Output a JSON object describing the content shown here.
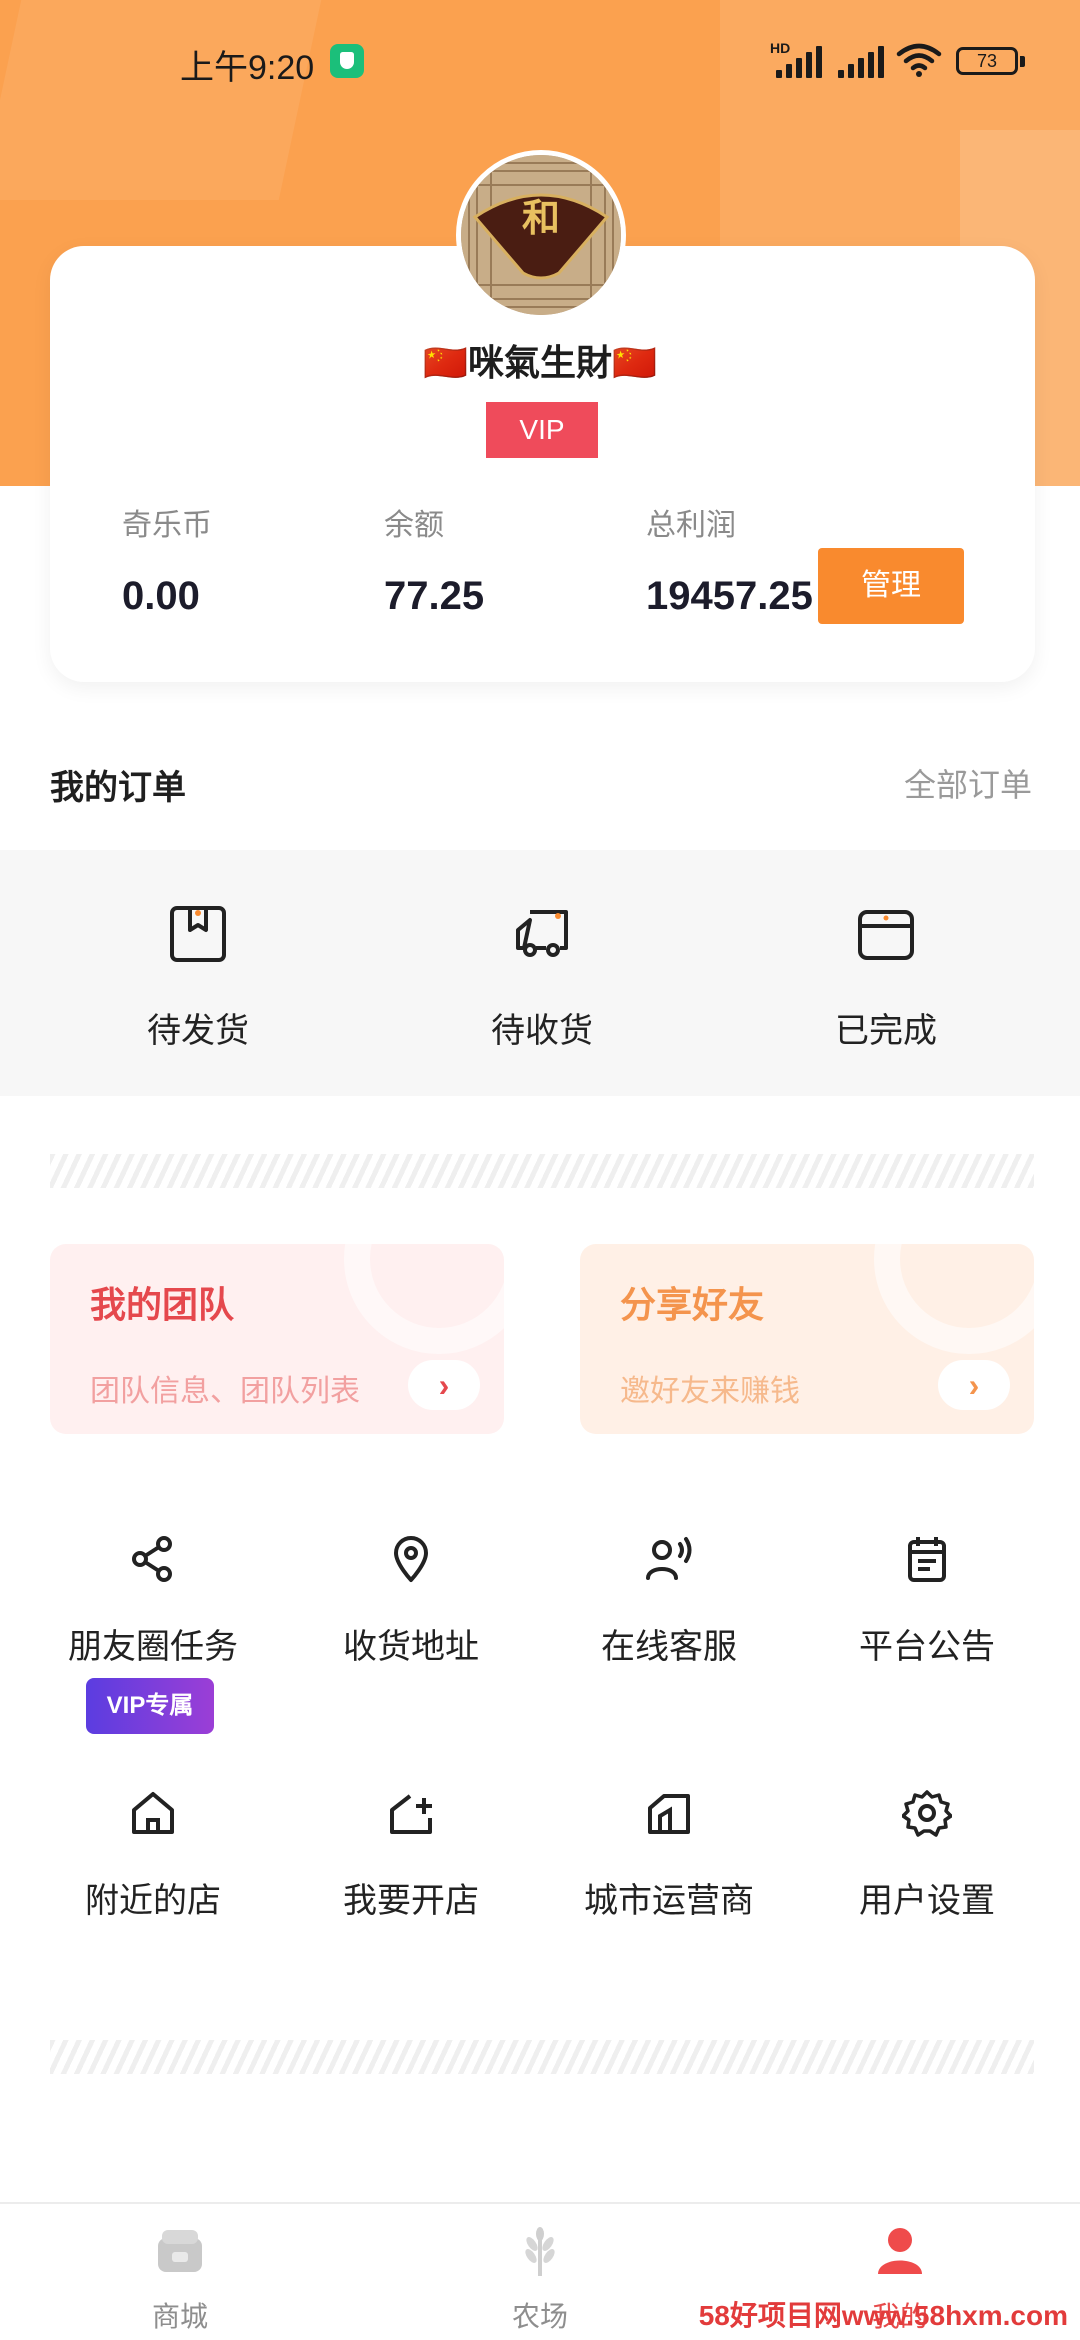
{
  "status_bar": {
    "time": "上午9:20",
    "network_label": "HD",
    "battery": "73"
  },
  "profile": {
    "avatar_character": "和",
    "username": "🇨🇳咪氣生財🇨🇳",
    "vip_label": "VIP",
    "stats": [
      {
        "label": "奇乐币",
        "value": "0.00"
      },
      {
        "label": "余额",
        "value": "77.25"
      },
      {
        "label": "总利润",
        "value": "19457.25"
      }
    ],
    "manage_label": "管理"
  },
  "orders": {
    "title": "我的订单",
    "all_label": "全部订单",
    "items": [
      {
        "label": "待发货",
        "icon": "box-icon"
      },
      {
        "label": "待收货",
        "icon": "truck-icon"
      },
      {
        "label": "已完成",
        "icon": "package-icon"
      }
    ]
  },
  "promos": {
    "team": {
      "title": "我的团队",
      "subtitle": "团队信息、团队列表",
      "arrow": "›"
    },
    "share": {
      "title": "分享好友",
      "subtitle": "邀好友来赚钱",
      "arrow": "›"
    }
  },
  "tools": [
    {
      "label": "朋友圈任务",
      "icon": "share-icon",
      "badge": "VIP专属"
    },
    {
      "label": "收货地址",
      "icon": "location-pin-icon"
    },
    {
      "label": "在线客服",
      "icon": "customer-service-icon"
    },
    {
      "label": "平台公告",
      "icon": "calendar-icon"
    },
    {
      "label": "附近的店",
      "icon": "home-icon"
    },
    {
      "label": "我要开店",
      "icon": "add-store-icon"
    },
    {
      "label": "城市运营商",
      "icon": "city-icon"
    },
    {
      "label": "用户设置",
      "icon": "gear-icon"
    }
  ],
  "bottom_nav": {
    "items": [
      {
        "label": "商城",
        "icon": "store-icon",
        "active": false
      },
      {
        "label": "农场",
        "icon": "wheat-icon",
        "active": false
      },
      {
        "label": "我的",
        "icon": "user-icon",
        "active": true
      }
    ],
    "watermark": "58好项目网www.58hxm.com"
  },
  "colors": {
    "header": "#fba14f",
    "accent_orange": "#f98a2e",
    "vip_red": "#ef4b5b",
    "active_red": "#e74a4a"
  }
}
